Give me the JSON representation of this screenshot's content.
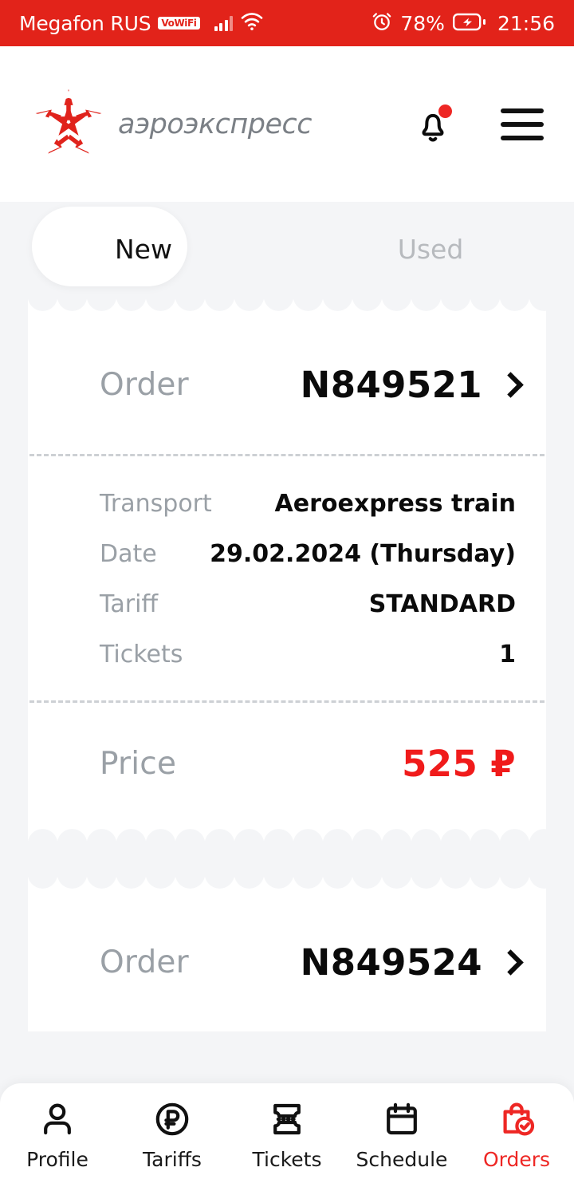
{
  "status_bar": {
    "carrier": "Megafon RUS",
    "wifi_calling_badge": "VoWiFi",
    "signal_icon": "cellular-signal-icon",
    "wifi_icon": "wifi-icon",
    "alarm_icon": "alarm-clock-icon",
    "battery_percent": "78%",
    "battery_icon": "battery-charging-icon",
    "time": "21:56",
    "background_color": "#e2231a"
  },
  "header": {
    "logo_icon": "aeroexpress-star-logo",
    "brand_name": "аэроэкспресс",
    "notifications_icon": "bell-icon",
    "notifications_has_badge": true,
    "menu_icon": "hamburger-menu-icon"
  },
  "tabs": {
    "items": [
      {
        "label": "New",
        "active": true
      },
      {
        "label": "Used",
        "active": false
      }
    ]
  },
  "orders": [
    {
      "order_label": "Order",
      "order_number": "N849521",
      "chevron_icon": "chevron-right-icon",
      "details": [
        {
          "label": "Transport",
          "value": "Aeroexpress train"
        },
        {
          "label": "Date",
          "value": "29.02.2024  (Thursday)"
        },
        {
          "label": "Tariff",
          "value": "STANDARD"
        },
        {
          "label": "Tickets",
          "value": "1"
        }
      ],
      "price_label": "Price",
      "price_value": "525 ₽"
    },
    {
      "order_label": "Order",
      "order_number": "N849524",
      "chevron_icon": "chevron-right-icon"
    }
  ],
  "bottom_nav": {
    "items": [
      {
        "label": "Profile",
        "icon": "person-icon",
        "active": false
      },
      {
        "label": "Tariffs",
        "icon": "ruble-circle-icon",
        "active": false
      },
      {
        "label": "Tickets",
        "icon": "ticket-icon",
        "active": false
      },
      {
        "label": "Schedule",
        "icon": "calendar-icon",
        "active": false
      },
      {
        "label": "Orders",
        "icon": "bag-check-icon",
        "active": true
      }
    ],
    "active_color": "#ee2724"
  },
  "theme": {
    "brand_red": "#e2231a",
    "price_red": "#f01b1b",
    "page_background": "#f4f5f7",
    "card_background": "#ffffff",
    "muted_text": "#9aa0a6"
  }
}
